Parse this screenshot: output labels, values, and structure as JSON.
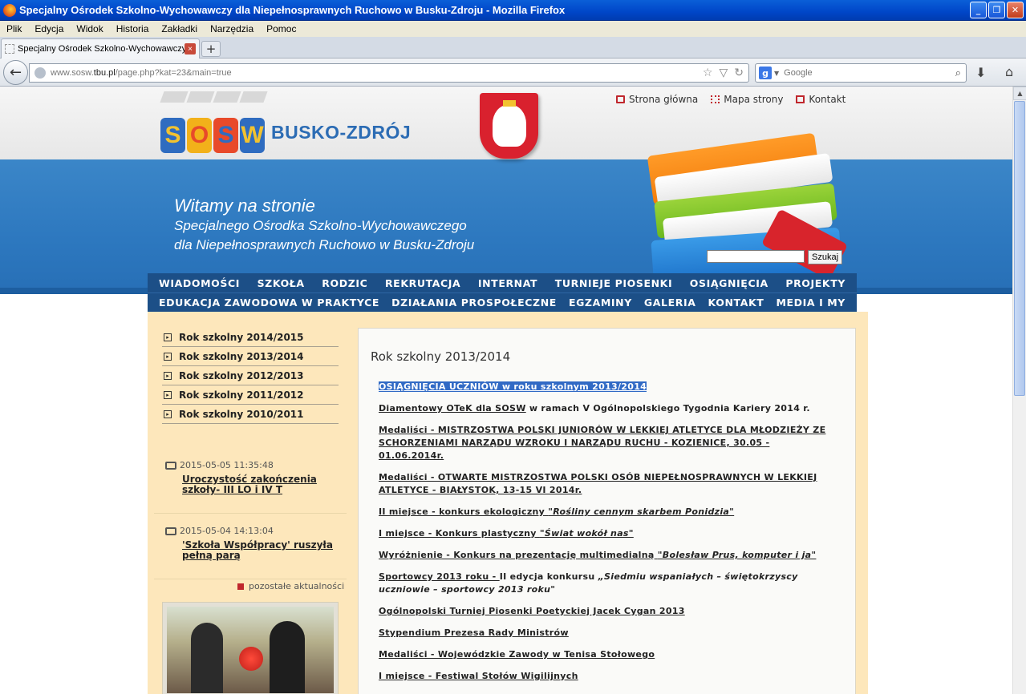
{
  "window": {
    "title": "Specjalny Ośrodek Szkolno-Wychowawczy dla Niepełnosprawnych Ruchowo w Busku-Zdroju - Mozilla Firefox",
    "buttons": {
      "minimize": "_",
      "maximize": "❐",
      "close": "✕"
    }
  },
  "menubar": [
    "Plik",
    "Edycja",
    "Widok",
    "Historia",
    "Zakładki",
    "Narzędzia",
    "Pomoc"
  ],
  "tab": {
    "label": "Specjalny Ośrodek Szkolno-Wychowawczy dl...",
    "close": "×",
    "new_tab": "+"
  },
  "navbar": {
    "url_prefix": "www.sosw.",
    "url_host": "tbu.pl",
    "url_path": "/page.php?kat=23&main=true",
    "search_engine_icon": "g",
    "search_placeholder": "Google"
  },
  "site": {
    "logo_letters": [
      "S",
      "O",
      "S",
      "W"
    ],
    "logo_colors": [
      "#2f6cc0",
      "#f2b11a",
      "#e84a2a",
      "#2f6cc0"
    ],
    "logo_text": "BUSKO-ZDRÓJ",
    "top_links": [
      "Strona główna",
      "Mapa strony",
      "Kontakt"
    ],
    "welcome": {
      "line1": "Witamy na stronie",
      "line2": "Specjalnego Ośrodka Szkolno-Wychowawczego",
      "line3": "dla Niepełnosprawnych Ruchowo w Busku-Zdroju"
    },
    "search_button": "Szukaj",
    "nav_row1": [
      "WIADOMOŚCI",
      "SZKOŁA",
      "RODZIC",
      "REKRUTACJA",
      "INTERNAT",
      "TURNIEJE PIOSENKI",
      "OSIĄGNIĘCIA",
      "PROJEKTY"
    ],
    "nav_row2": [
      "EDUKACJA ZAWODOWA W PRAKTYCE",
      "DZIAŁANIA PROSPOŁECZNE",
      "EGZAMINY",
      "GALERIA",
      "KONTAKT",
      "MEDIA I MY"
    ]
  },
  "sidebar": {
    "years": [
      "Rok szkolny 2014/2015",
      "Rok szkolny 2013/2014",
      "Rok szkolny 2012/2013",
      "Rok szkolny 2011/2012",
      "Rok szkolny 2010/2011"
    ],
    "news": [
      {
        "date": "2015-05-05 11:35:48",
        "title": "Uroczystość zakończenia szkoły- III LO i IV T"
      },
      {
        "date": "2015-05-04 14:13:04",
        "title": "'Szkoła Współpracy' ruszyła pełną parą"
      }
    ],
    "more_news": "pozostałe aktualności"
  },
  "main": {
    "heading": "Rok szkolny 2013/2014",
    "items": [
      {
        "parts": [
          {
            "t": "OSIĄGNIĘCIA UCZNIÓW w roku szkolnym 2013/2014",
            "s": "u"
          }
        ],
        "highlight": true
      },
      {
        "parts": [
          {
            "t": "Diamentowy OTeK dla SOSW",
            "s": "u"
          },
          {
            "t": "  w ramach V Ogólnopolskiego Tygodnia Kariery 2014 r.",
            "s": ""
          }
        ]
      },
      {
        "parts": [
          {
            "t": "Medaliści - MISTRZOSTWA POLSKI JUNIORÓW W LEKKIEJ ATLETYCE  DLA MŁODZIEŻY ZE SCHORZENIAMI  NARZĄDU WZROKU I NARZĄDU RUCHU - KOZIENICE, 30.05 - 01.06.2014r.",
            "s": "u"
          }
        ]
      },
      {
        "parts": [
          {
            "t": "Medaliści - OTWARTE MISTRZOSTWA POLSKI OSÓB NIEPEŁNOSPRAWNYCH  W LEKKIEJ ATLETYCE  - BIAŁYSTOK, 13-15 VI 2014r.",
            "s": "u"
          }
        ]
      },
      {
        "parts": [
          {
            "t": "II miejsce - konkurs ekologiczny ",
            "s": "u"
          },
          {
            "t": "\"Rośliny cennym skarbem Ponidzia\"",
            "s": "ui"
          }
        ]
      },
      {
        "parts": [
          {
            "t": "I miejsce - Konkurs plastyczny ",
            "s": "u"
          },
          {
            "t": "\"Świat wokół nas\"",
            "s": "ui"
          }
        ]
      },
      {
        "parts": [
          {
            "t": "Wyróżnienie - Konkurs na prezentację multimedialną ",
            "s": "u"
          },
          {
            "t": "\"Bolesław Prus, komputer i ja\"",
            "s": "ui"
          }
        ]
      },
      {
        "parts": [
          {
            "t": "Sportowcy 2013 roku - ",
            "s": "u"
          },
          {
            "t": " II edycja konkursu ",
            "s": ""
          },
          {
            "t": "„Siedmiu wspaniałych – świętokrzyscy uczniowie – sportowcy 2013 roku\"",
            "s": "i"
          }
        ]
      },
      {
        "parts": [
          {
            "t": "Ogólnopolski Turniej Piosenki Poetyckiej Jacek Cygan 2013",
            "s": "u"
          }
        ]
      },
      {
        "parts": [
          {
            "t": "Stypendium Prezesa Rady Ministrów",
            "s": "u"
          }
        ]
      },
      {
        "parts": [
          {
            "t": "Medaliści - Wojewódzkie Zawody w Tenisa Stołowego",
            "s": "u"
          }
        ]
      },
      {
        "parts": [
          {
            "t": "I miejsce - Festiwal Stołów Wigilijnych",
            "s": "u"
          }
        ]
      }
    ]
  },
  "colors": {
    "header_blue": "#2d78bf",
    "nav_blue": "#1c4f87",
    "content_bg": "#fde7bb",
    "accent_red": "#c0272d"
  }
}
